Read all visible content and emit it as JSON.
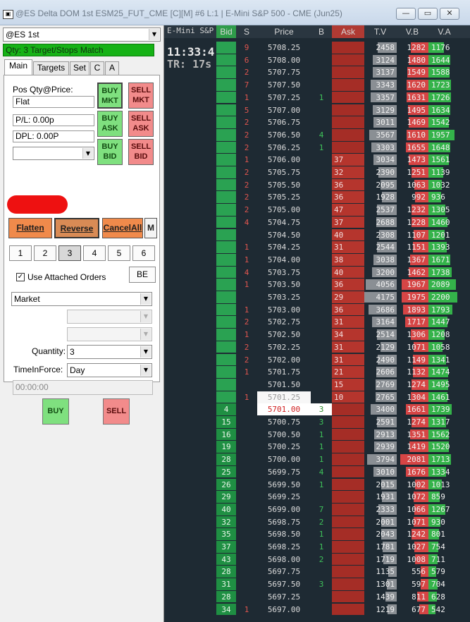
{
  "window": {
    "title": "@ES Delta DOM 1st ESM25_FUT_CME [C][M] #6 L:1 | E-Mini S&P 500 - CME (Jun25)"
  },
  "order_panel": {
    "symbol": "@ES 1st",
    "status": "Qty: 3 Target/Stops Match",
    "tabs": [
      "Main",
      "Targets",
      "Set",
      "C",
      "A"
    ],
    "pos_label": "Pos Qty@Price:",
    "pos_value": "Flat",
    "pl_value": "P/L: 0.00p",
    "dpl_value": "DPL: 0.00P",
    "buy_mkt": [
      "BUY",
      "MKT"
    ],
    "sell_mkt": [
      "SELL",
      "MKT"
    ],
    "buy_ask": [
      "BUY",
      "ASK"
    ],
    "sell_ask": [
      "SELL",
      "ASK"
    ],
    "buy_bid": [
      "BUY",
      "BID"
    ],
    "sell_bid": [
      "SELL",
      "BID"
    ],
    "flatten": "Flatten",
    "reverse": "Reverse",
    "cancel_all": "CancelAll",
    "m_label": "M",
    "qty_buttons": [
      "1",
      "2",
      "3",
      "4",
      "5",
      "6"
    ],
    "selected_qty": "3",
    "use_attached_orders": "Use Attached Orders",
    "be_label": "BE",
    "order_type": "Market",
    "quantity_label": "Quantity:",
    "quantity_value": "3",
    "tif_label": "TimeInForce:",
    "tif_value": "Day",
    "time_value": "00:00:00",
    "buy_label": "BUY",
    "sell_label": "SELL"
  },
  "dom": {
    "instrument_short": "E-Mini S&P",
    "clock": "11:33:4",
    "tr": "TR: 17s",
    "headers": [
      "Bid",
      "S",
      "Price",
      "B",
      "Ask",
      "T.V",
      "V.B",
      "V.A"
    ],
    "colors": {
      "bid_green": "#1ea54a",
      "ask_red": "#a93226",
      "up_color": "#3bb33b",
      "down_color": "#d64545"
    },
    "rows": [
      {
        "bid": "",
        "s": "9",
        "price": "5708.25",
        "b": "",
        "ask": "",
        "tv": "2458",
        "vb": "1282",
        "va": "1176"
      },
      {
        "bid": "",
        "s": "6",
        "price": "5708.00",
        "b": "",
        "ask": "",
        "tv": "3124",
        "vb": "1480",
        "va": "1644"
      },
      {
        "bid": "",
        "s": "2",
        "price": "5707.75",
        "b": "",
        "ask": "",
        "tv": "3137",
        "vb": "1549",
        "va": "1588"
      },
      {
        "bid": "",
        "s": "7",
        "price": "5707.50",
        "b": "",
        "ask": "",
        "tv": "3343",
        "vb": "1620",
        "va": "1723"
      },
      {
        "bid": "",
        "s": "1",
        "price": "5707.25",
        "b": "1",
        "ask": "",
        "tv": "3357",
        "vb": "1631",
        "va": "1726"
      },
      {
        "bid": "",
        "s": "5",
        "price": "5707.00",
        "b": "",
        "ask": "",
        "tv": "3129",
        "vb": "1495",
        "va": "1634"
      },
      {
        "bid": "",
        "s": "2",
        "price": "5706.75",
        "b": "",
        "ask": "",
        "tv": "3011",
        "vb": "1469",
        "va": "1542"
      },
      {
        "bid": "",
        "s": "2",
        "price": "5706.50",
        "b": "4",
        "ask": "",
        "tv": "3567",
        "vb": "1610",
        "va": "1957"
      },
      {
        "bid": "",
        "s": "2",
        "price": "5706.25",
        "b": "1",
        "ask": "",
        "tv": "3303",
        "vb": "1655",
        "va": "1648"
      },
      {
        "bid": "",
        "s": "1",
        "price": "5706.00",
        "b": "",
        "ask": "37",
        "tv": "3034",
        "vb": "1473",
        "va": "1561"
      },
      {
        "bid": "",
        "s": "2",
        "price": "5705.75",
        "b": "",
        "ask": "32",
        "tv": "2390",
        "vb": "1251",
        "va": "1139"
      },
      {
        "bid": "",
        "s": "2",
        "price": "5705.50",
        "b": "",
        "ask": "36",
        "tv": "2095",
        "vb": "1063",
        "va": "1032"
      },
      {
        "bid": "",
        "s": "2",
        "price": "5705.25",
        "b": "",
        "ask": "36",
        "tv": "1928",
        "vb": "992",
        "va": "936"
      },
      {
        "bid": "",
        "s": "2",
        "price": "5705.00",
        "b": "",
        "ask": "47",
        "tv": "2537",
        "vb": "1232",
        "va": "1305"
      },
      {
        "bid": "",
        "s": "4",
        "price": "5704.75",
        "b": "",
        "ask": "37",
        "tv": "2688",
        "vb": "1228",
        "va": "1460"
      },
      {
        "bid": "",
        "s": "",
        "price": "5704.50",
        "b": "",
        "ask": "40",
        "tv": "2308",
        "vb": "1107",
        "va": "1201"
      },
      {
        "bid": "",
        "s": "1",
        "price": "5704.25",
        "b": "",
        "ask": "31",
        "tv": "2544",
        "vb": "1151",
        "va": "1393"
      },
      {
        "bid": "",
        "s": "1",
        "price": "5704.00",
        "b": "",
        "ask": "38",
        "tv": "3038",
        "vb": "1367",
        "va": "1671"
      },
      {
        "bid": "",
        "s": "4",
        "price": "5703.75",
        "b": "",
        "ask": "40",
        "tv": "3200",
        "vb": "1462",
        "va": "1738"
      },
      {
        "bid": "",
        "s": "1",
        "price": "5703.50",
        "b": "",
        "ask": "36",
        "tv": "4056",
        "vb": "1967",
        "va": "2089"
      },
      {
        "bid": "",
        "s": "",
        "price": "5703.25",
        "b": "",
        "ask": "29",
        "tv": "4175",
        "vb": "1975",
        "va": "2200"
      },
      {
        "bid": "",
        "s": "1",
        "price": "5703.00",
        "b": "",
        "ask": "36",
        "tv": "3686",
        "vb": "1893",
        "va": "1793"
      },
      {
        "bid": "",
        "s": "2",
        "price": "5702.75",
        "b": "",
        "ask": "31",
        "tv": "3164",
        "vb": "1717",
        "va": "1447"
      },
      {
        "bid": "",
        "s": "1",
        "price": "5702.50",
        "b": "",
        "ask": "34",
        "tv": "2514",
        "vb": "1306",
        "va": "1208"
      },
      {
        "bid": "",
        "s": "2",
        "price": "5702.25",
        "b": "",
        "ask": "31",
        "tv": "2129",
        "vb": "1071",
        "va": "1058"
      },
      {
        "bid": "",
        "s": "2",
        "price": "5702.00",
        "b": "",
        "ask": "31",
        "tv": "2490",
        "vb": "1149",
        "va": "1341"
      },
      {
        "bid": "",
        "s": "1",
        "price": "5701.75",
        "b": "",
        "ask": "21",
        "tv": "2606",
        "vb": "1132",
        "va": "1474"
      },
      {
        "bid": "",
        "s": "",
        "price": "5701.50",
        "b": "",
        "ask": "15",
        "tv": "2769",
        "vb": "1274",
        "va": "1495"
      },
      {
        "bid": "",
        "s": "1",
        "price": "5701.25",
        "b": "",
        "ask": "10",
        "tv": "2765",
        "vb": "1304",
        "va": "1461"
      },
      {
        "bid": "4",
        "s": "",
        "price": "5701.00",
        "b": "3",
        "ask": "",
        "tv": "3400",
        "vb": "1661",
        "va": "1739"
      },
      {
        "bid": "15",
        "s": "",
        "price": "5700.75",
        "b": "3",
        "ask": "",
        "tv": "2591",
        "vb": "1274",
        "va": "1317"
      },
      {
        "bid": "16",
        "s": "",
        "price": "5700.50",
        "b": "1",
        "ask": "",
        "tv": "2913",
        "vb": "1351",
        "va": "1562"
      },
      {
        "bid": "19",
        "s": "",
        "price": "5700.25",
        "b": "1",
        "ask": "",
        "tv": "2939",
        "vb": "1419",
        "va": "1520"
      },
      {
        "bid": "28",
        "s": "",
        "price": "5700.00",
        "b": "1",
        "ask": "",
        "tv": "3794",
        "vb": "2081",
        "va": "1713"
      },
      {
        "bid": "25",
        "s": "",
        "price": "5699.75",
        "b": "4",
        "ask": "",
        "tv": "3010",
        "vb": "1676",
        "va": "1334"
      },
      {
        "bid": "26",
        "s": "",
        "price": "5699.50",
        "b": "1",
        "ask": "",
        "tv": "2015",
        "vb": "1002",
        "va": "1013"
      },
      {
        "bid": "29",
        "s": "",
        "price": "5699.25",
        "b": "",
        "ask": "",
        "tv": "1931",
        "vb": "1072",
        "va": "859"
      },
      {
        "bid": "40",
        "s": "",
        "price": "5699.00",
        "b": "7",
        "ask": "",
        "tv": "2333",
        "vb": "1066",
        "va": "1267"
      },
      {
        "bid": "32",
        "s": "",
        "price": "5698.75",
        "b": "2",
        "ask": "",
        "tv": "2001",
        "vb": "1071",
        "va": "930"
      },
      {
        "bid": "35",
        "s": "",
        "price": "5698.50",
        "b": "1",
        "ask": "",
        "tv": "2043",
        "vb": "1242",
        "va": "801"
      },
      {
        "bid": "37",
        "s": "",
        "price": "5698.25",
        "b": "1",
        "ask": "",
        "tv": "1781",
        "vb": "1027",
        "va": "754"
      },
      {
        "bid": "43",
        "s": "",
        "price": "5698.00",
        "b": "2",
        "ask": "",
        "tv": "1719",
        "vb": "1008",
        "va": "711"
      },
      {
        "bid": "28",
        "s": "",
        "price": "5697.75",
        "b": "",
        "ask": "",
        "tv": "1135",
        "vb": "556",
        "va": "579"
      },
      {
        "bid": "31",
        "s": "",
        "price": "5697.50",
        "b": "3",
        "ask": "",
        "tv": "1301",
        "vb": "597",
        "va": "704"
      },
      {
        "bid": "28",
        "s": "",
        "price": "5697.25",
        "b": "",
        "ask": "",
        "tv": "1439",
        "vb": "811",
        "va": "628"
      },
      {
        "bid": "34",
        "s": "1",
        "price": "5697.00",
        "b": "",
        "ask": "",
        "tv": "1219",
        "vb": "677",
        "va": "542"
      }
    ]
  }
}
